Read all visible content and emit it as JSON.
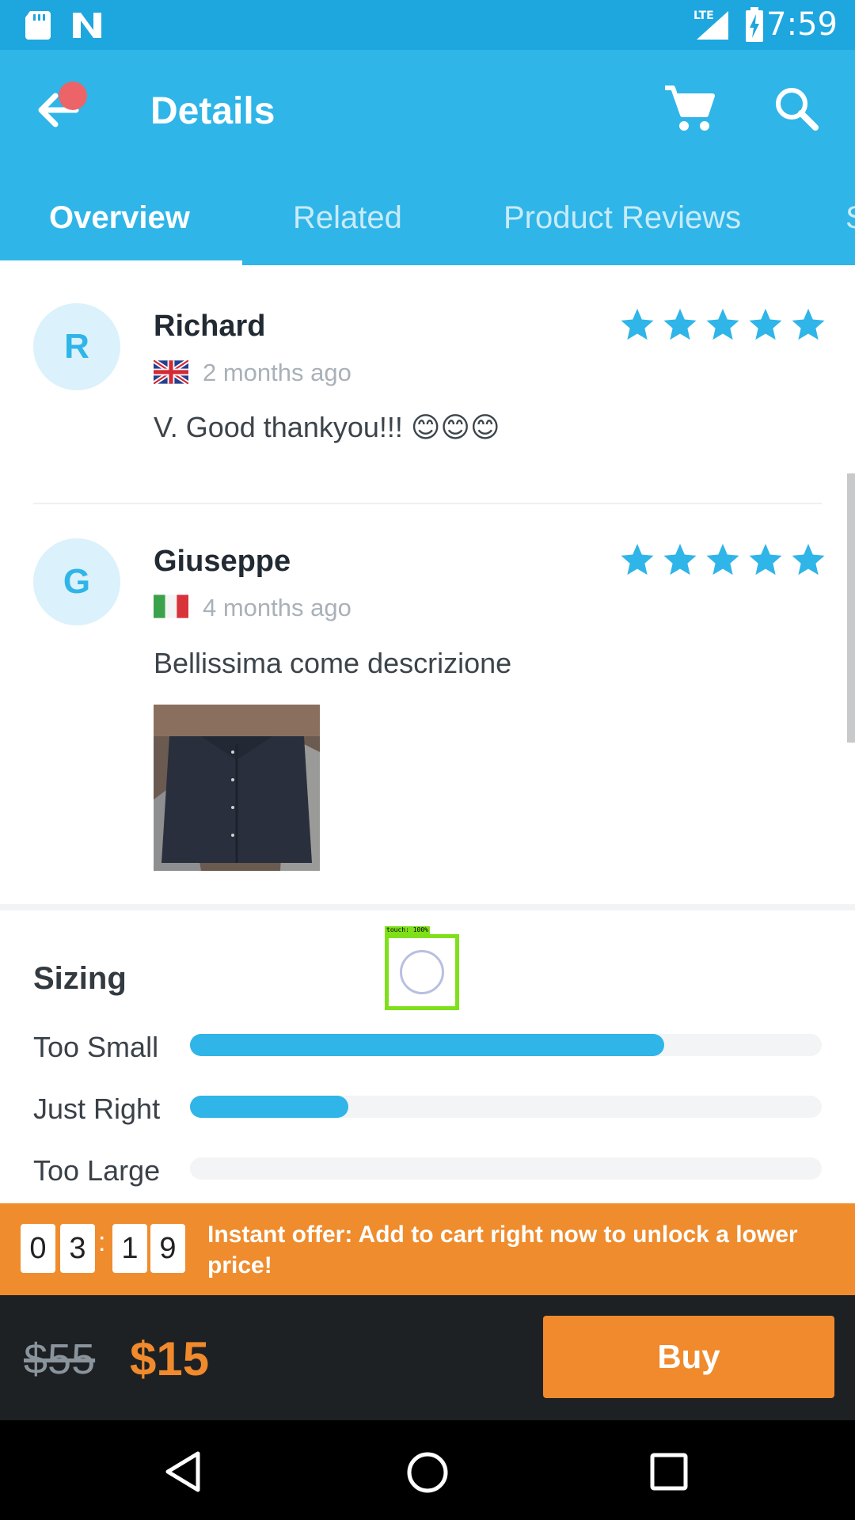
{
  "status_bar": {
    "time": "7:59",
    "network": "LTE"
  },
  "app_bar": {
    "title": "Details"
  },
  "tabs": [
    {
      "label": "Overview",
      "active": true
    },
    {
      "label": "Related",
      "active": false
    },
    {
      "label": "Product Reviews",
      "active": false
    },
    {
      "label": "S",
      "active": false
    }
  ],
  "reviews": [
    {
      "initial": "R",
      "name": "Richard",
      "flag": "uk-flag",
      "date": "2 months ago",
      "text": "V. Good thankyou!!! 😊😊😊",
      "rating": 5
    },
    {
      "initial": "G",
      "name": "Giuseppe",
      "flag": "italy-flag",
      "date": "4 months ago",
      "text": "Bellissima come descrizione",
      "rating": 5,
      "has_photo": true
    }
  ],
  "touch_indicator": {
    "label": "touch: 100%"
  },
  "sizing": {
    "title": "Sizing",
    "rows": [
      {
        "label": "Too Small",
        "fraction": 0.75
      },
      {
        "label": "Just Right",
        "fraction": 0.25
      },
      {
        "label": "Too Large",
        "fraction": 0.0
      }
    ]
  },
  "offer": {
    "timer_digits": [
      "0",
      "3",
      "1",
      "9"
    ],
    "separator": ":",
    "text": "Instant offer: Add to cart right now to unlock a lower price!"
  },
  "price": {
    "old": "$55",
    "new": "$15",
    "buy_label": "Buy"
  },
  "colors": {
    "primary": "#2fb5e8",
    "accent": "#f08a2c",
    "dark": "#1e2124"
  }
}
